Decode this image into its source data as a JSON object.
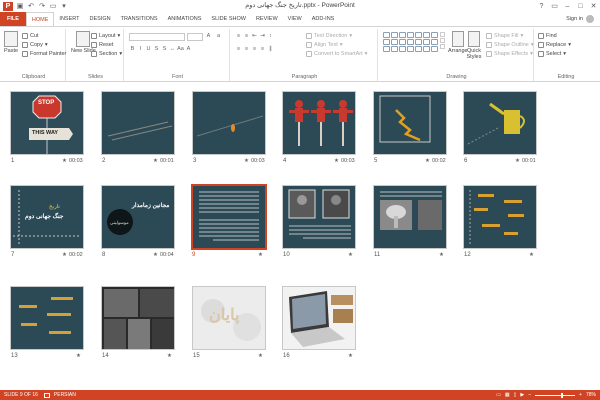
{
  "window": {
    "title": "تاریخ جنگ جهانی دوم.pptx - PowerPoint"
  },
  "tabs": [
    "FILE",
    "HOME",
    "INSERT",
    "DESIGN",
    "TRANSITIONS",
    "ANIMATIONS",
    "SLIDE SHOW",
    "REVIEW",
    "VIEW",
    "ADD-INS"
  ],
  "account": {
    "sign_in": "Sign in"
  },
  "ribbon": {
    "clipboard": {
      "paste": "Paste",
      "cut": "Cut",
      "copy": "Copy",
      "format_painter": "Format Painter",
      "label": "Clipboard"
    },
    "slides": {
      "new_slide": "New Slide",
      "layout": "Layout",
      "reset": "Reset",
      "section": "Section",
      "label": "Slides"
    },
    "font": {
      "label": "Font"
    },
    "paragraph": {
      "text_direction": "Text Direction",
      "align_text": "Align Text",
      "convert_smartart": "Convert to SmartArt",
      "label": "Paragraph"
    },
    "drawing": {
      "arrange": "Arrange",
      "quick_styles": "Quick Styles",
      "shape_fill": "Shape Fill",
      "shape_outline": "Shape Outline",
      "shape_effects": "Shape Effects",
      "label": "Drawing"
    },
    "editing": {
      "find": "Find",
      "replace": "Replace",
      "select": "Select",
      "label": "Editing"
    }
  },
  "slides": [
    {
      "num": "1",
      "time": "00:03"
    },
    {
      "num": "2",
      "time": "00:01"
    },
    {
      "num": "3",
      "time": "00:03"
    },
    {
      "num": "4",
      "time": "00:03"
    },
    {
      "num": "5",
      "time": "00:02"
    },
    {
      "num": "6",
      "time": "00:01"
    },
    {
      "num": "7",
      "time": "00:02"
    },
    {
      "num": "8",
      "time": "00:04"
    },
    {
      "num": "9",
      "time": ""
    },
    {
      "num": "10",
      "time": ""
    },
    {
      "num": "11",
      "time": ""
    },
    {
      "num": "12",
      "time": ""
    },
    {
      "num": "13",
      "time": ""
    },
    {
      "num": "14",
      "time": ""
    },
    {
      "num": "15",
      "time": ""
    },
    {
      "num": "16",
      "time": ""
    }
  ],
  "slide_text": {
    "s1_sign1": "STOP",
    "s1_sign2": "THIS WAY",
    "s7_title1": "تاریخ",
    "s7_title2": "جنگ جهانی دوم",
    "s8_title": "مجانین زمامدار",
    "s8_circle": "موسولینی",
    "s15_word": "پایان"
  },
  "status": {
    "slide_of": "SLIDE 9 OF 16",
    "language": "PERSIAN",
    "zoom": "78%"
  },
  "selected_slide": "9"
}
